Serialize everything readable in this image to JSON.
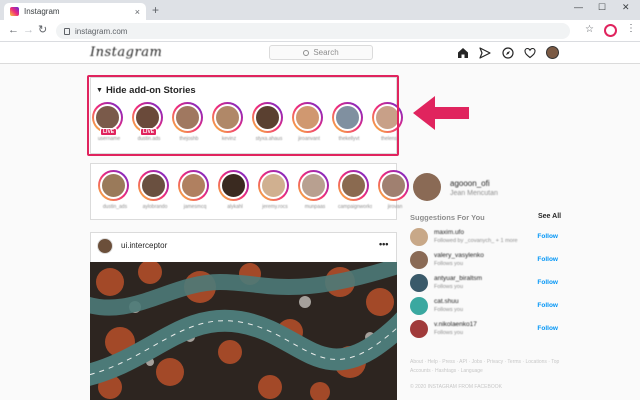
{
  "browser": {
    "tab_title": "Instagram",
    "tab_close": "×",
    "new_tab": "+",
    "url": "instagram.com",
    "win_min": "—",
    "win_max": "☐",
    "win_close": "✕",
    "back": "←",
    "forward": "→",
    "reload": "↻",
    "star": "☆",
    "menu": "⋮"
  },
  "header": {
    "logo": "Instagram",
    "search_placeholder": "Search"
  },
  "addon": {
    "title": "Hide add-on Stories",
    "chevron": "▼",
    "stories": [
      {
        "username": "username",
        "live": true,
        "color": "#7a5a4a"
      },
      {
        "username": "dustin.ads",
        "live": true,
        "color": "#6a4a3a"
      },
      {
        "username": "thejoshb",
        "live": false,
        "color": "#a07860"
      },
      {
        "username": "kevinz",
        "live": false,
        "color": "#b08868"
      },
      {
        "username": "styxa.ahaus",
        "live": false,
        "color": "#5a4030"
      },
      {
        "username": "jiroanvant",
        "live": false,
        "color": "#d09870"
      },
      {
        "username": "thekellyvt",
        "live": false,
        "color": "#8090a0"
      },
      {
        "username": "thelens",
        "live": false,
        "color": "#c8a088"
      }
    ],
    "live_label": "LIVE"
  },
  "stories": [
    {
      "username": "dustin_ads",
      "color": "#9a7a5a"
    },
    {
      "username": "aylobrando",
      "color": "#6a5040"
    },
    {
      "username": "jamesmcq",
      "color": "#b08060"
    },
    {
      "username": "alykahl",
      "color": "#3a2a20"
    },
    {
      "username": "jeremy.rocs",
      "color": "#d0b090"
    },
    {
      "username": "munpaas",
      "color": "#b8a090"
    },
    {
      "username": "campaignworks",
      "color": "#8a6a50"
    },
    {
      "username": "jirovan",
      "color": "#a08070"
    }
  ],
  "post": {
    "username": "ui.interceptor",
    "more": "•••"
  },
  "sidebar": {
    "username": "agooon_ofi",
    "fullname": "Jean Mencutan",
    "suggestions_title": "Suggestions For You",
    "see_all": "See All",
    "follow_label": "Follow",
    "suggestions": [
      {
        "name": "maxim.ufo",
        "sub": "Followed by _covanych_ + 1 more",
        "color": "#c8a888"
      },
      {
        "name": "valery_vasylenko",
        "sub": "Follows you",
        "color": "#8a6a55"
      },
      {
        "name": "antyuar_biraltsm",
        "sub": "Follows you",
        "color": "#3a5a6a"
      },
      {
        "name": "cat.shuu",
        "sub": "Follows you",
        "color": "#3aa8a0"
      },
      {
        "name": "v.nikolaenko17",
        "sub": "Follows you",
        "color": "#a03a3a"
      }
    ],
    "footer_links": "About · Help · Press · API · Jobs · Privacy · Terms · Locations · Top Accounts · Hashtags · Language",
    "copyright": "© 2020 INSTAGRAM FROM FACEBOOK"
  },
  "colors": {
    "highlight": "#e0245e",
    "link": "#0095f6"
  }
}
